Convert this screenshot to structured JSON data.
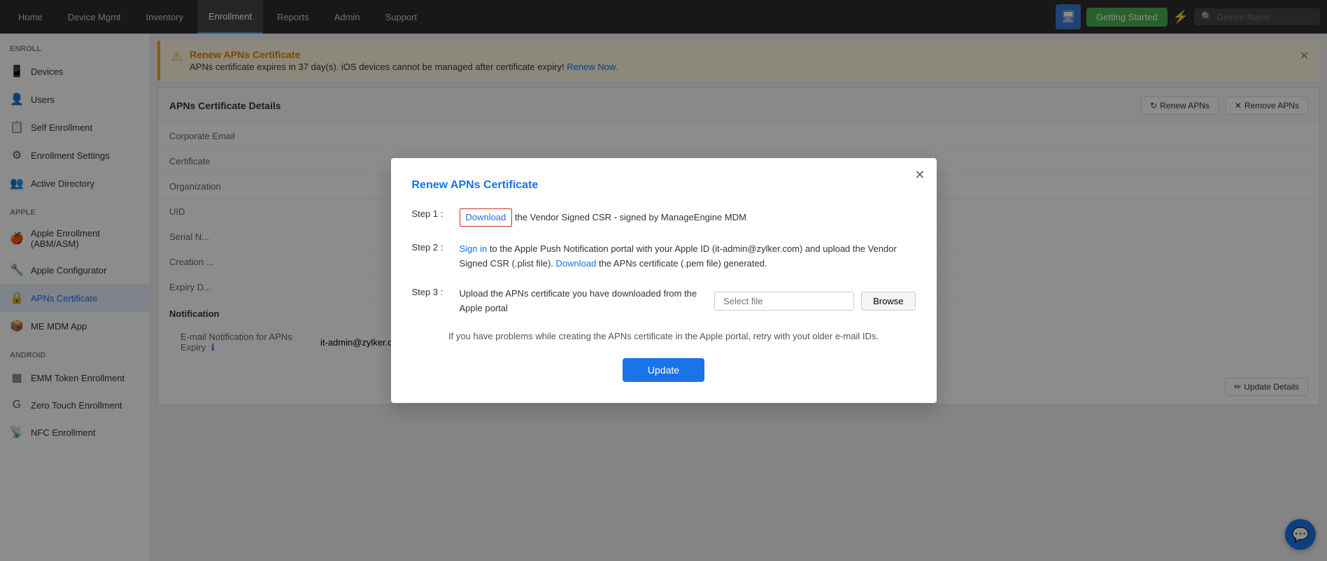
{
  "nav": {
    "items": [
      {
        "label": "Home",
        "active": false
      },
      {
        "label": "Device Mgmt",
        "active": false
      },
      {
        "label": "Inventory",
        "active": false
      },
      {
        "label": "Enrollment",
        "active": true
      },
      {
        "label": "Reports",
        "active": false
      },
      {
        "label": "Admin",
        "active": false
      },
      {
        "label": "Support",
        "active": false
      }
    ],
    "getting_started": "Getting Started",
    "search_placeholder": "Device Name"
  },
  "sidebar": {
    "enroll_label": "Enroll",
    "items_enroll": [
      {
        "label": "Devices",
        "icon": "📱"
      },
      {
        "label": "Users",
        "icon": "👤"
      },
      {
        "label": "Self Enrollment",
        "icon": "📋"
      },
      {
        "label": "Enrollment Settings",
        "icon": "⚙"
      },
      {
        "label": "Active Directory",
        "icon": "👥"
      }
    ],
    "apple_label": "Apple",
    "items_apple": [
      {
        "label": "Apple Enrollment (ABM/ASM)",
        "icon": "🍎"
      },
      {
        "label": "Apple Configurator",
        "icon": "🔧"
      },
      {
        "label": "APNs Certificate",
        "icon": "🔒"
      },
      {
        "label": "ME MDM App",
        "icon": "📦"
      }
    ],
    "android_label": "Android",
    "items_android": [
      {
        "label": "EMM Token Enrollment",
        "icon": "▦"
      },
      {
        "label": "Zero Touch Enrollment",
        "icon": "G"
      },
      {
        "label": "NFC Enrollment",
        "icon": "📡"
      }
    ]
  },
  "banner": {
    "title": "Renew APNs Certificate",
    "message": "APNs certificate expires in 37 day(s). iOS devices cannot be managed after certificate expiry!",
    "renew_link": "Renew Now."
  },
  "details_section": {
    "title": "APNs Certificate Details",
    "renew_btn": "Renew APNs",
    "remove_btn": "Remove APNs",
    "update_btn": "Update Details",
    "rows": [
      {
        "label": "Corporate Email"
      },
      {
        "label": "Certificate"
      },
      {
        "label": "Organization"
      },
      {
        "label": "UID"
      },
      {
        "label": "Serial N..."
      },
      {
        "label": "Creation ..."
      },
      {
        "label": "Expiry D..."
      }
    ],
    "notification_title": "Notification",
    "notif_row_label": "E-mail Notification for APNs Expiry",
    "notif_row_value": "it-admin@zylker.com"
  },
  "modal": {
    "title": "Renew APNs Certificate",
    "step1_label": "Step 1 :",
    "step1_download": "Download",
    "step1_rest": "the Vendor Signed CSR - signed by ManageEngine MDM",
    "step2_label": "Step 2 :",
    "step2_text1": "Sign in",
    "step2_text2": "to the Apple Push Notification portal with your Apple ID (it-admin@zylker.com) and upload the Vendor Signed CSR (.plist file).",
    "step2_link": "Download",
    "step2_text3": "the APNs certificate (.pem file) generated.",
    "step3_label": "Step 3 :",
    "step3_text": "Upload the APNs certificate you have downloaded from the Apple portal",
    "file_placeholder": "Select file",
    "browse_btn": "Browse",
    "note": "If you have problems while creating the APNs certificate in the Apple portal, retry with yout older e-mail IDs.",
    "update_btn": "Update"
  }
}
